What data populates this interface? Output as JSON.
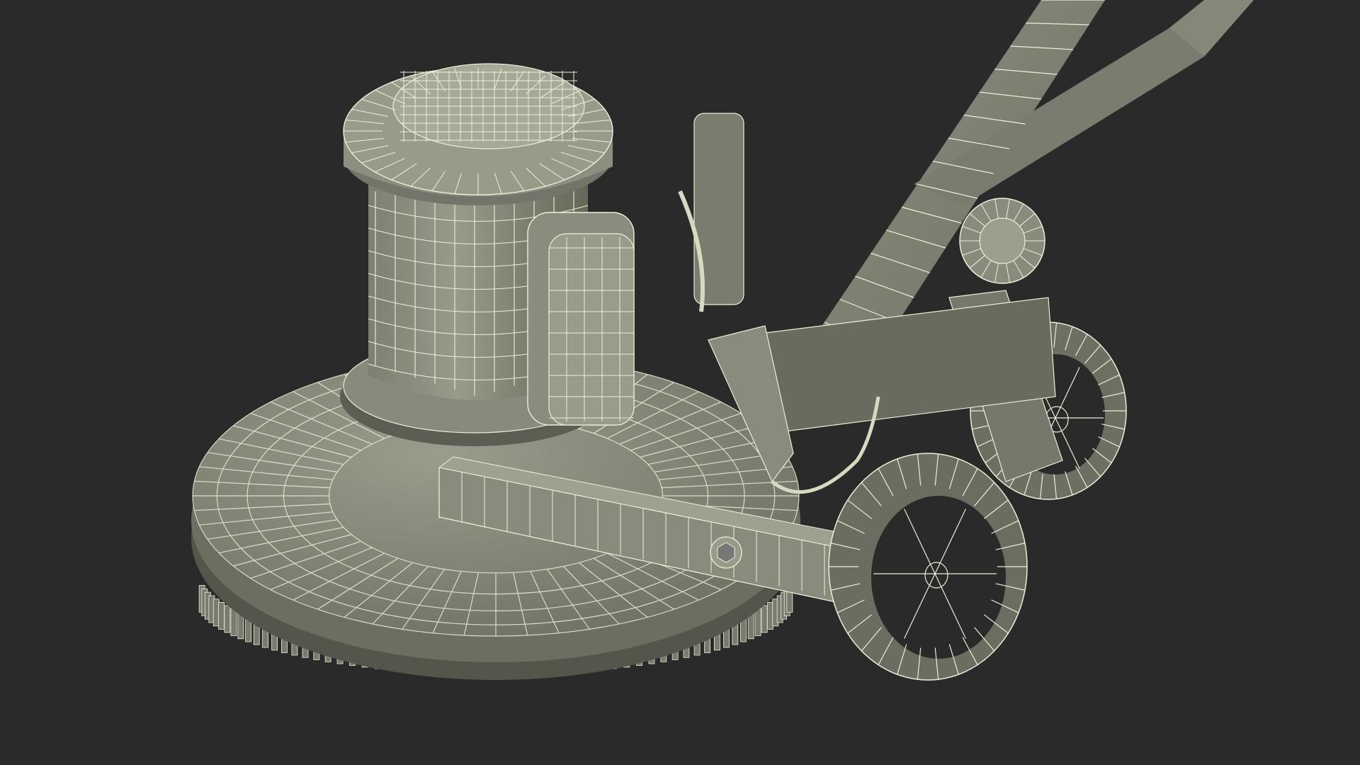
{
  "scene": {
    "subject": "floor-scrubber-wireframe",
    "background_color": "#2a2a2a",
    "surface_color": "#8a8a7c",
    "surface_shadow_color": "#5f5f55",
    "surface_highlight_color": "#a3a394",
    "wire_color": "#eeeed8",
    "dark_color": "#1f1f1f"
  }
}
